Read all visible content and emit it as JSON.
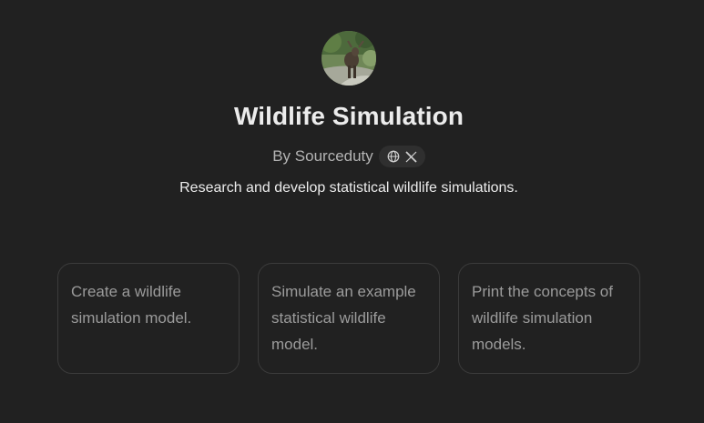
{
  "gpt": {
    "title": "Wildlife Simulation",
    "byline": "By Sourceduty",
    "description": "Research and develop statistical wildlife simulations.",
    "social_icons": [
      "globe-icon",
      "x-logo-icon"
    ]
  },
  "starters": [
    {
      "text": "Create a wildlife simulation model."
    },
    {
      "text": "Simulate an example statistical wildlife model."
    },
    {
      "text": "Print the concepts of wildlife simulation models."
    }
  ],
  "colors": {
    "background": "#212121",
    "card_border": "#3b3b3b",
    "title": "#ececec",
    "muted": "#b4b4b4",
    "card_text": "#9b9b9b",
    "pill": "#2f2f2f"
  }
}
